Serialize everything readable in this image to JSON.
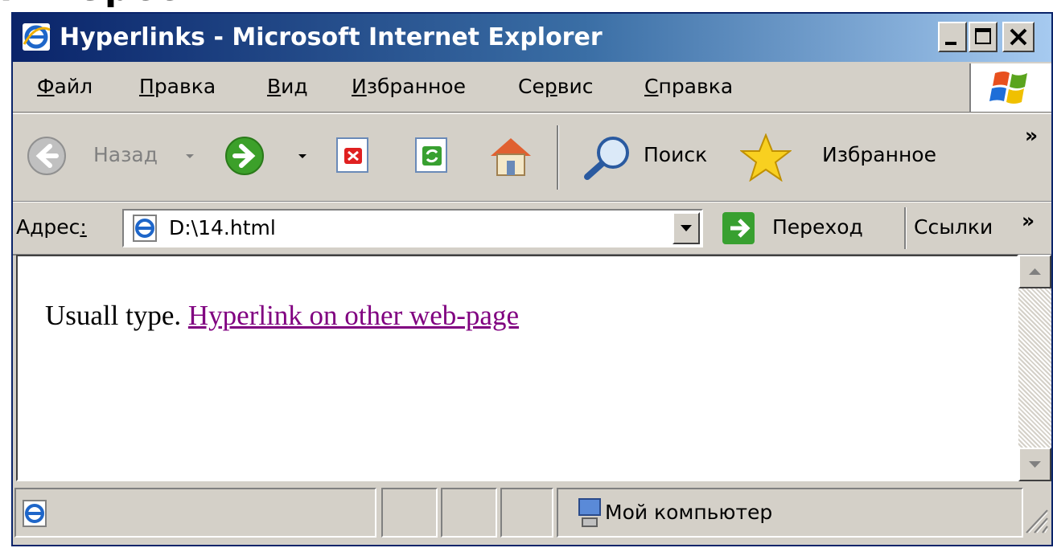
{
  "slide": {
    "title_fragment": "гиперссылки"
  },
  "window": {
    "title": "Hyperlinks - Microsoft Internet Explorer",
    "controls": [
      "minimize",
      "maximize",
      "close"
    ]
  },
  "menu": {
    "items": [
      {
        "pre": "",
        "key": "Ф",
        "post": "айл"
      },
      {
        "pre": "",
        "key": "П",
        "post": "равка"
      },
      {
        "pre": "",
        "key": "В",
        "post": "ид"
      },
      {
        "pre": "",
        "key": "И",
        "post": "збранное"
      },
      {
        "pre": "Се",
        "key": "р",
        "post": "вис"
      },
      {
        "pre": "",
        "key": "С",
        "post": "правка"
      }
    ]
  },
  "toolbar": {
    "back_label": "Назад",
    "search_label": "Поиск",
    "favorites_label": "Избранное",
    "chevron": "»"
  },
  "address": {
    "label_pre": "Адрес",
    "label_key": ":",
    "value": "D:\\14.html",
    "go_label": "Переход",
    "links_label": "Ссылки",
    "chevron": "»"
  },
  "page": {
    "text": "Usuall type.",
    "link_text": "Hyperlink on other web-page",
    "link_color": "#800080"
  },
  "status": {
    "zone_text": "Мой компьютер"
  },
  "colors": {
    "titlebar_start": "#0a246a",
    "titlebar_end": "#a6caf0",
    "chrome": "#d4d0c8"
  }
}
